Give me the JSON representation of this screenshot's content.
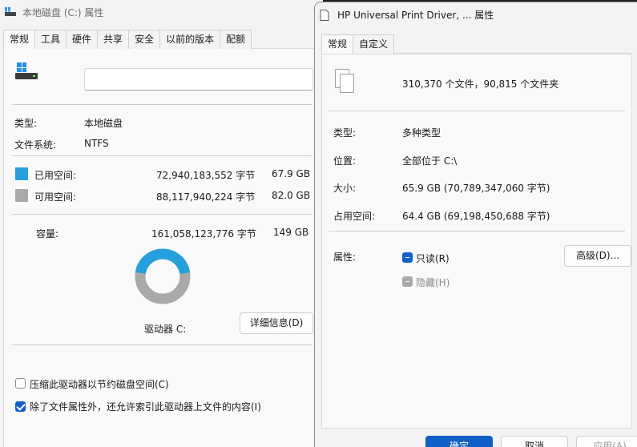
{
  "left_window": {
    "title": "本地磁盘 (C:) 属性",
    "tabs": [
      "常规",
      "工具",
      "硬件",
      "共享",
      "安全",
      "以前的版本",
      "配额"
    ],
    "general": {
      "type_label": "类型:",
      "type_value": "本地磁盘",
      "fs_label": "文件系统:",
      "fs_value": "NTFS",
      "used_label": "已用空间:",
      "used_bytes": "72,940,183,552 字节",
      "used_size": "67.9 GB",
      "used_color": "#26a0da",
      "free_label": "可用空间:",
      "free_bytes": "88,117,940,224 字节",
      "free_size": "82.0 GB",
      "free_color": "#a9a9a9",
      "capacity_label": "容量:",
      "capacity_bytes": "161,058,123,776 字节",
      "capacity_size": "149 GB",
      "used_fraction": 0.453,
      "drive_label": "驱动器 C:",
      "details_button": "详细信息(D)",
      "compress_label": "压缩此驱动器以节约磁盘空间(C)",
      "compress_checked": false,
      "index_label": "除了文件属性外，还允许索引此驱动器上文件的内容(I)",
      "index_checked": true
    },
    "icons": {
      "title": "drive-icon",
      "drive": "windows-drive-icon"
    }
  },
  "right_window": {
    "title": "HP Universal Print Driver, ... 属性",
    "tabs": [
      "常规",
      "自定义"
    ],
    "general": {
      "summary": "310,370 个文件，90,815 个文件夹",
      "type_label": "类型:",
      "type_value": "多种类型",
      "location_label": "位置:",
      "location_value": "全部位于 C:\\",
      "size_label": "大小:",
      "size_value": "65.9 GB (70,789,347,060 字节)",
      "disk_label": "占用空间:",
      "disk_value": "64.4 GB (69,198,450,688 字节)",
      "attr_label": "属性:",
      "readonly_label": "只读(R)",
      "hidden_label": "隐藏(H)",
      "advanced_button": "高级(D)..."
    },
    "buttons": {
      "ok": "确定",
      "cancel": "取消",
      "apply": "应用(A)"
    },
    "icons": {
      "title": "file-icon",
      "files": "multiple-files-icon"
    }
  }
}
